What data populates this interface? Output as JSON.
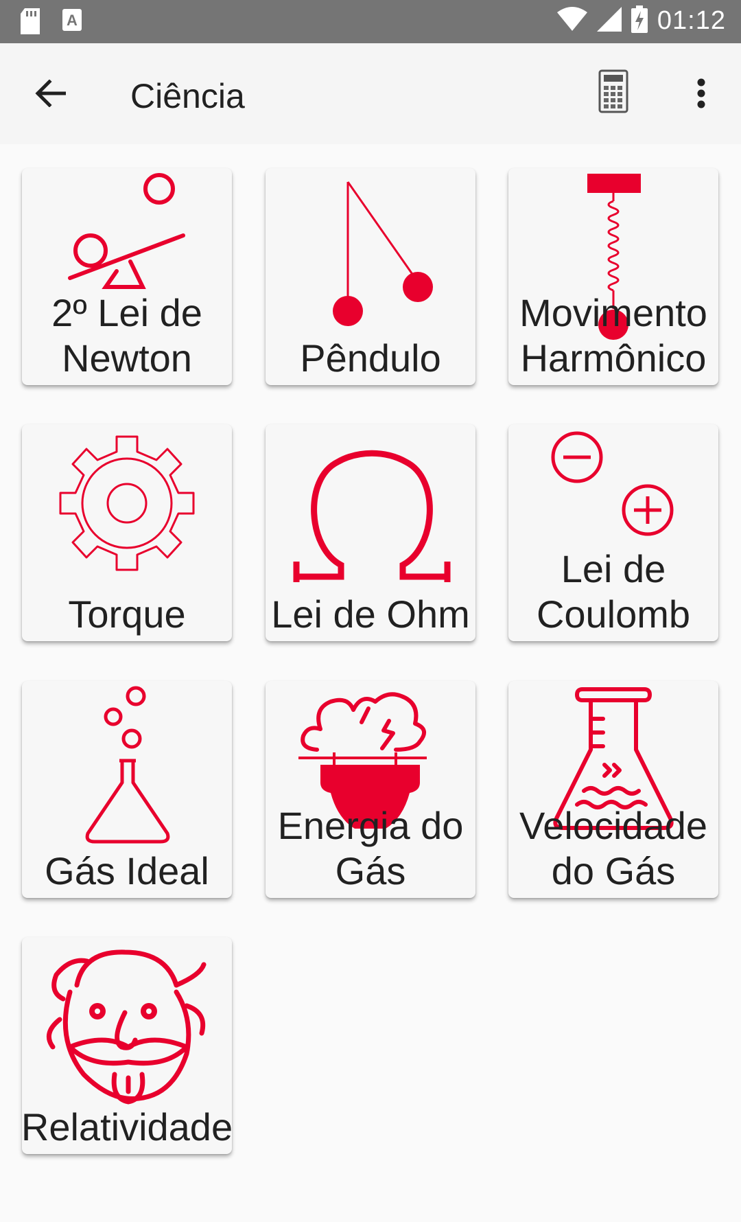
{
  "status_bar": {
    "time": "01:12",
    "icons": [
      "sd-card-icon",
      "text-a-icon",
      "wifi-icon",
      "signal-icon",
      "battery-charging-icon"
    ]
  },
  "app_bar": {
    "title": "Ciência",
    "back_icon": "arrow-back-icon",
    "calculator_icon": "calculator-icon",
    "more_icon": "more-vert-icon"
  },
  "accent_color": "#e8002d",
  "items": [
    {
      "label": "2º Lei de\nNewton",
      "icon": "seesaw-icon"
    },
    {
      "label": "Pêndulo",
      "icon": "pendulum-icon"
    },
    {
      "label": "Movimento\nHarmônico",
      "icon": "spring-icon"
    },
    {
      "label": "Torque",
      "icon": "gear-icon"
    },
    {
      "label": "Lei de Ohm",
      "icon": "omega-icon"
    },
    {
      "label": "Lei de\nCoulomb",
      "icon": "charges-icon"
    },
    {
      "label": "Gás Ideal",
      "icon": "flask-bubbles-icon"
    },
    {
      "label": "Energia do\nGás",
      "icon": "gas-energy-icon"
    },
    {
      "label": "Velocidade\ndo Gás",
      "icon": "erlenmeyer-icon"
    },
    {
      "label": "Relatividade",
      "icon": "einstein-icon"
    }
  ]
}
